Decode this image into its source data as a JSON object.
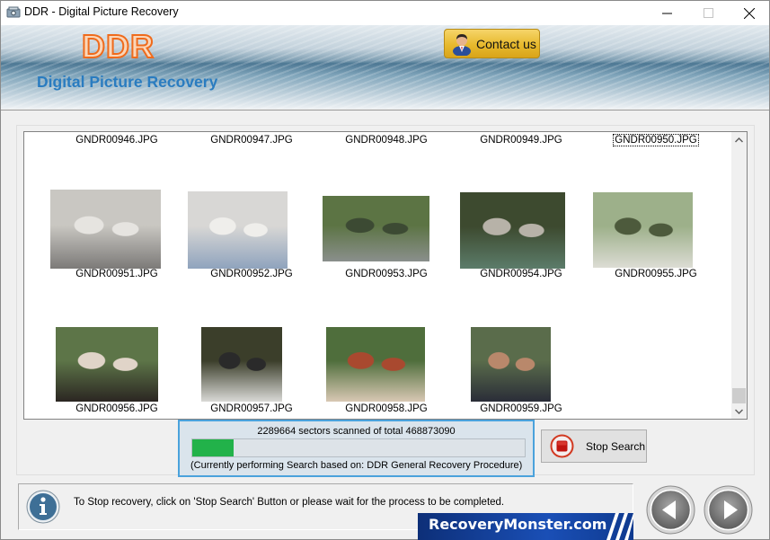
{
  "window": {
    "title": "DDR - Digital Picture Recovery",
    "minimize_symbol": "—",
    "maximize_symbol": "☐",
    "close_symbol": "✕"
  },
  "header": {
    "logo": "DDR",
    "subtitle": "Digital Picture Recovery",
    "contact_label": "Contact us",
    "contact_icon": "person-icon"
  },
  "thumbnails": {
    "rows": [
      [
        {
          "name": "GNDR00946.JPG"
        },
        {
          "name": "GNDR00947.JPG"
        },
        {
          "name": "GNDR00948.JPG"
        },
        {
          "name": "GNDR00949.JPG"
        },
        {
          "name": "GNDR00950.JPG",
          "focused": true
        }
      ],
      [
        {
          "name": "GNDR00951.JPG",
          "colors": [
            "#c9c7c2",
            "#7c7a78",
            "#e6e4e0"
          ]
        },
        {
          "name": "GNDR00952.JPG",
          "colors": [
            "#d8d7d5",
            "#8fa3bd",
            "#efeeeb"
          ]
        },
        {
          "name": "GNDR00953.JPG",
          "colors": [
            "#5c7444",
            "#8a8f8c",
            "#3c4a33"
          ]
        },
        {
          "name": "GNDR00954.JPG",
          "colors": [
            "#3d4a2f",
            "#5c7c6a",
            "#b7b2a8"
          ]
        },
        {
          "name": "GNDR00955.JPG",
          "colors": [
            "#9db08a",
            "#dcdcd4",
            "#4d5a3c"
          ]
        }
      ],
      [
        {
          "name": "GNDR00956.JPG",
          "colors": [
            "#5d7548",
            "#2b2622",
            "#e0d4c8"
          ]
        },
        {
          "name": "GNDR00957.JPG",
          "colors": [
            "#3b3e2a",
            "#d9d9d6",
            "#2a2a2a"
          ]
        },
        {
          "name": "GNDR00958.JPG",
          "colors": [
            "#4f6e3c",
            "#d9c8b4",
            "#a9492f"
          ]
        },
        {
          "name": "GNDR00959.JPG",
          "colors": [
            "#5a6c4b",
            "#2a2d38",
            "#b9886b"
          ]
        }
      ]
    ]
  },
  "progress": {
    "status_text": "2289664 sectors scanned of total 468873090",
    "sectors_scanned": 2289664,
    "sectors_total": 468873090,
    "bar_fraction": 0.125,
    "bar_color": "#22b24a",
    "procedure_text": "(Currently performing Search based on:  DDR General Recovery Procedure)"
  },
  "stop_button": {
    "label": "Stop Search"
  },
  "info": {
    "text": "To Stop recovery, click on 'Stop Search' Button or please wait for the process to be completed."
  },
  "brand": {
    "text": "RecoveryMonster.com"
  },
  "nav": {
    "back": "back-arrow",
    "next": "next-arrow"
  }
}
